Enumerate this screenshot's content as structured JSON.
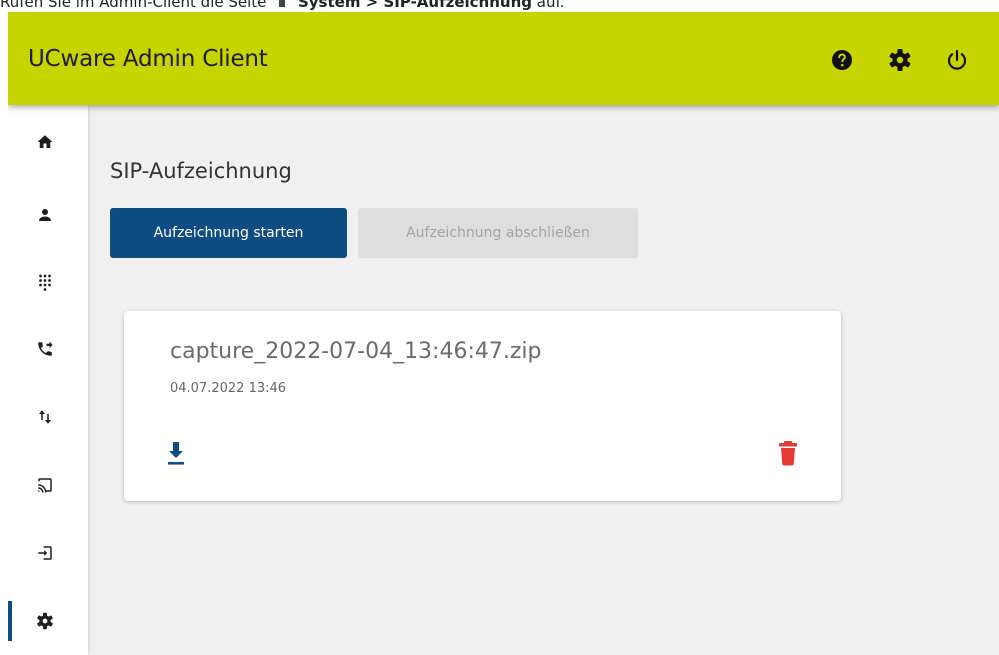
{
  "doc_text": {
    "prefix": "Rufen Sie im Admin-Client die Seite",
    "path": "System > SIP-Aufzeichnung",
    "suffix": "auf."
  },
  "header": {
    "title": "UCware Admin Client",
    "icons": [
      "help-icon",
      "settings-icon",
      "power-icon"
    ]
  },
  "sidebar": {
    "items": [
      {
        "icon": "home-icon"
      },
      {
        "icon": "person-icon"
      },
      {
        "icon": "dialpad-icon"
      },
      {
        "icon": "phone-forward-icon"
      },
      {
        "icon": "swap-vert-icon"
      },
      {
        "icon": "cast-icon"
      },
      {
        "icon": "login-icon"
      },
      {
        "icon": "settings-icon",
        "active": true
      }
    ]
  },
  "main": {
    "title": "SIP-Aufzeichnung",
    "start_button": "Aufzeichnung starten",
    "stop_button": "Aufzeichnung abschließen",
    "recordings": [
      {
        "filename": "capture_2022-07-04_13:46:47.zip",
        "date": "04.07.2022 13:46"
      }
    ]
  },
  "colors": {
    "header_bg": "#c6d400",
    "primary": "#0f4c81",
    "delete": "#e53935",
    "background": "#f0f0f0"
  }
}
